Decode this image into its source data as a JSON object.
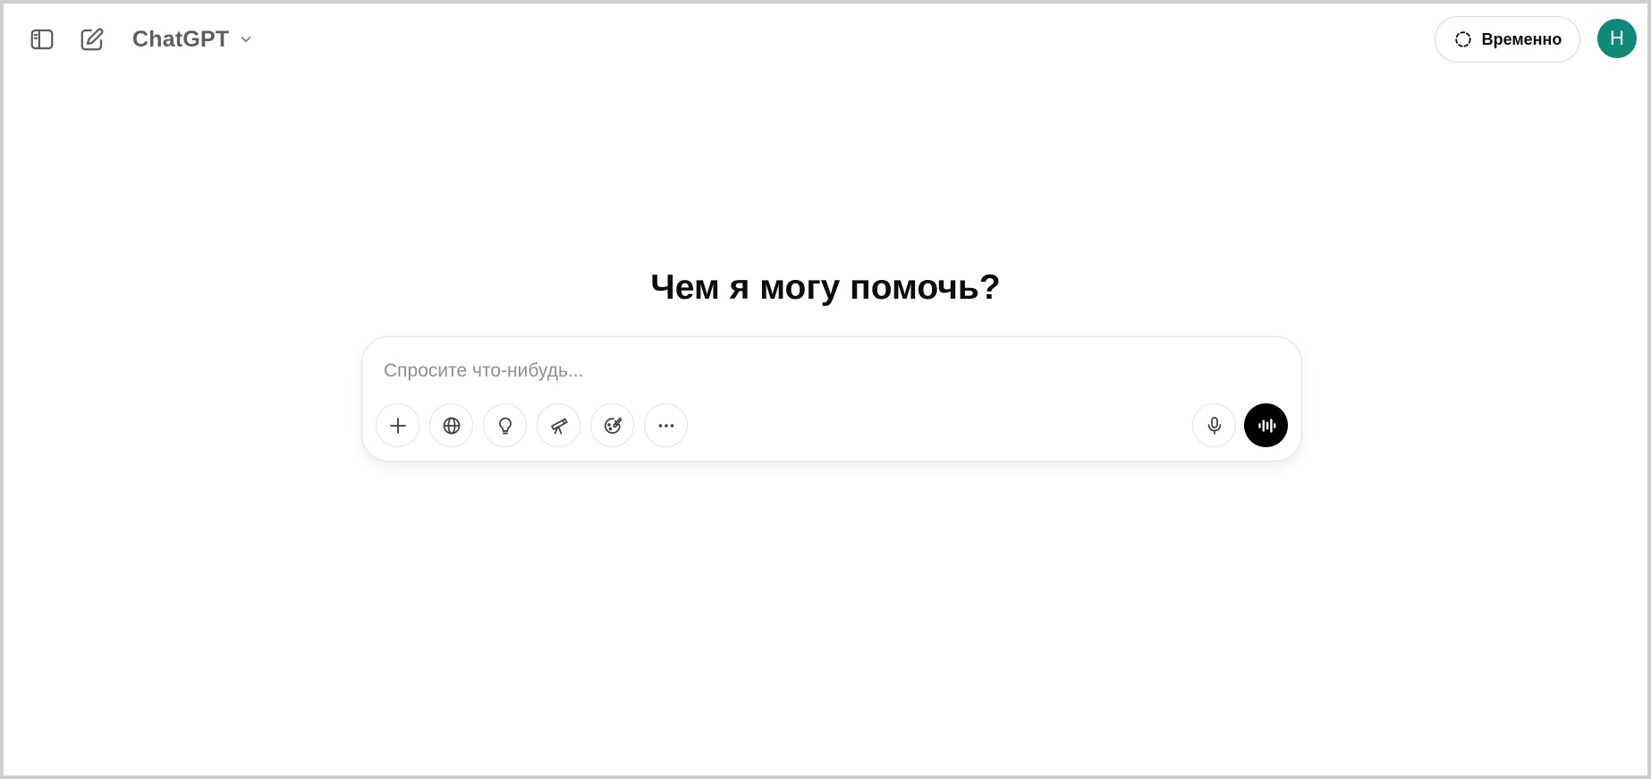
{
  "header": {
    "model_name": "ChatGPT",
    "temporary_label": "Временно",
    "avatar_initial": "H",
    "avatar_color": "#0f8a78"
  },
  "main": {
    "headline": "Чем я могу помочь?",
    "composer": {
      "placeholder": "Спросите что-нибудь...",
      "value": ""
    }
  },
  "icons": {
    "sidebar_toggle": "sidebar-toggle-icon",
    "new_chat": "edit-icon",
    "model_dropdown": "chevron-down-icon",
    "temporary": "dashed-circle-icon",
    "attach": "plus-icon",
    "search": "globe-icon",
    "reason": "lightbulb-icon",
    "deep_research": "telescope-icon",
    "image": "palette-icon",
    "more": "ellipsis-icon",
    "dictate": "microphone-icon",
    "voice_mode": "voice-waveform-icon"
  }
}
